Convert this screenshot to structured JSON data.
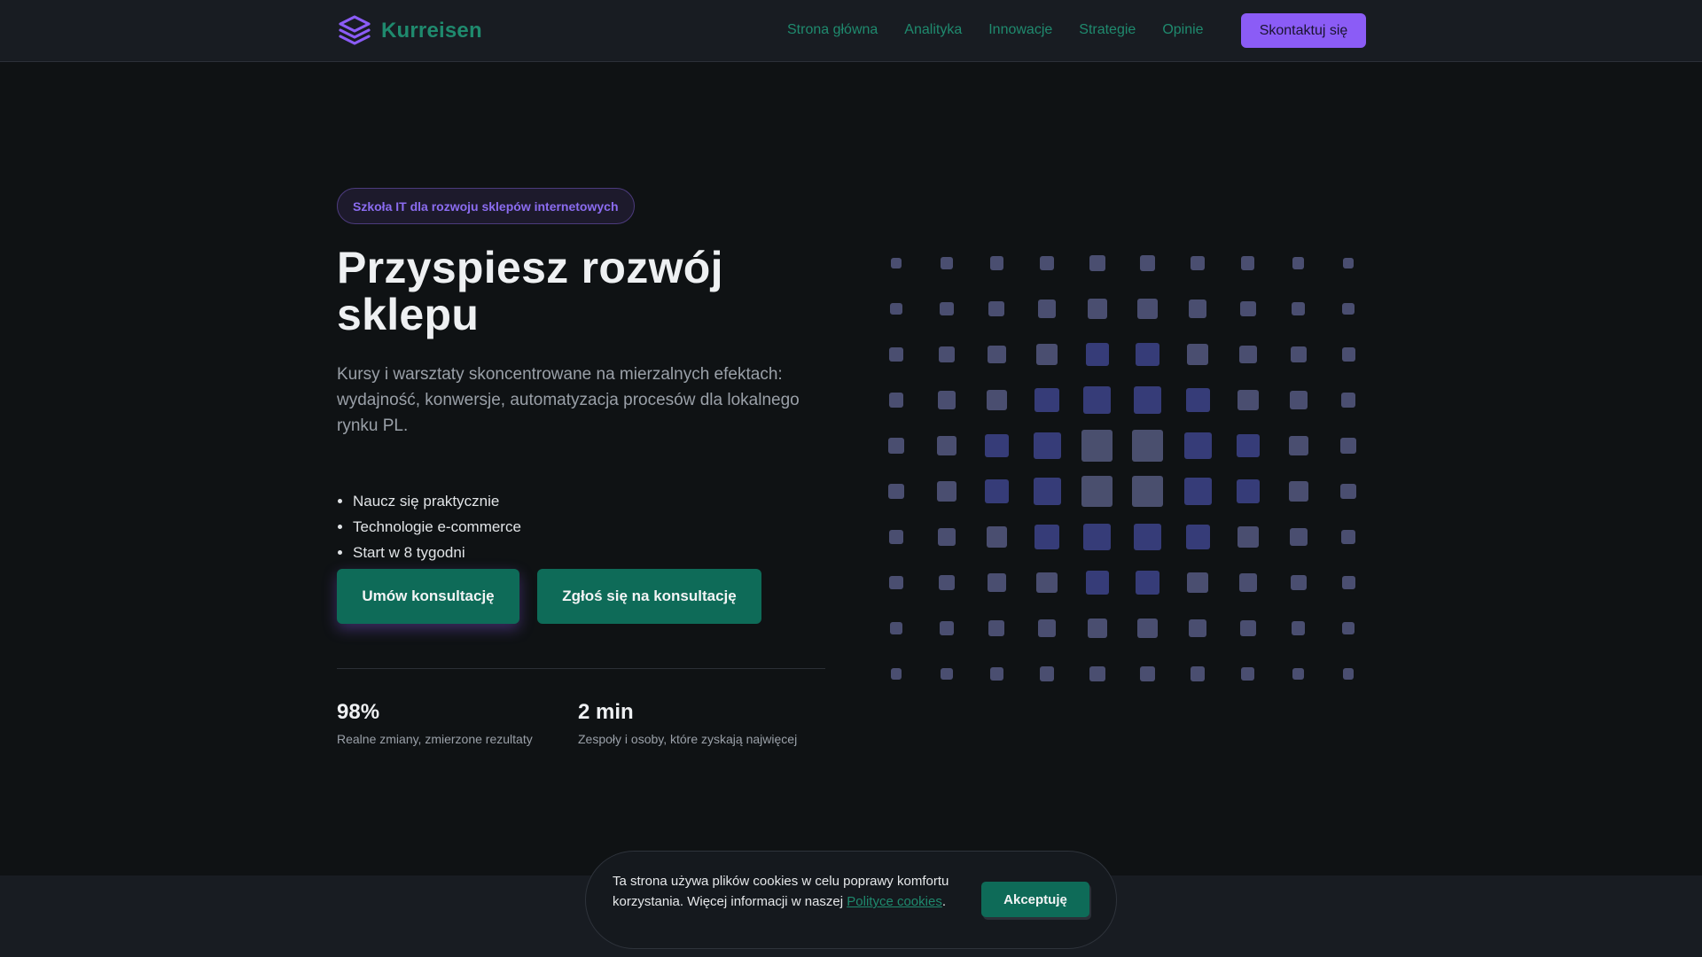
{
  "brand": {
    "name": "Kurreisen",
    "logo_icon": "layers-icon",
    "accent": "#8b5cf6",
    "green": "#1f8a6e"
  },
  "nav": {
    "items": [
      {
        "label": "Strona główna"
      },
      {
        "label": "Analityka"
      },
      {
        "label": "Innowacje"
      },
      {
        "label": "Strategie"
      },
      {
        "label": "Opinie"
      }
    ],
    "contact_label": "Skontaktuj się"
  },
  "hero": {
    "badge": "Szkoła IT dla rozwoju sklepów internetowych",
    "title": "Przyspiesz rozwój sklepu",
    "subtitle": "Kursy i warsztaty skoncentrowane na mierzalnych efektach: wydajność, konwersje, automatyzacja procesów dla lokalnego rynku PL.",
    "bullets": [
      "Naucz się praktycznie",
      "Technologie e-commerce",
      "Start w 8 tygodni"
    ],
    "primary_button": "Umów konsultację",
    "secondary_button": "Zgłoś się na konsultację"
  },
  "stats": [
    {
      "value": "98%",
      "label": "Realne zmiany, zmierzone rezultaty"
    },
    {
      "value": "2 min",
      "label": "Zespoły i osoby, które zyskają najwięcej"
    }
  ],
  "cookie": {
    "text": "Ta strona używa plików cookies w celu poprawy komfortu korzystania. Więcej informacji w naszej ",
    "link_text": "Polityce cookies",
    "after": ".",
    "accept_label": "Akceptuję"
  }
}
